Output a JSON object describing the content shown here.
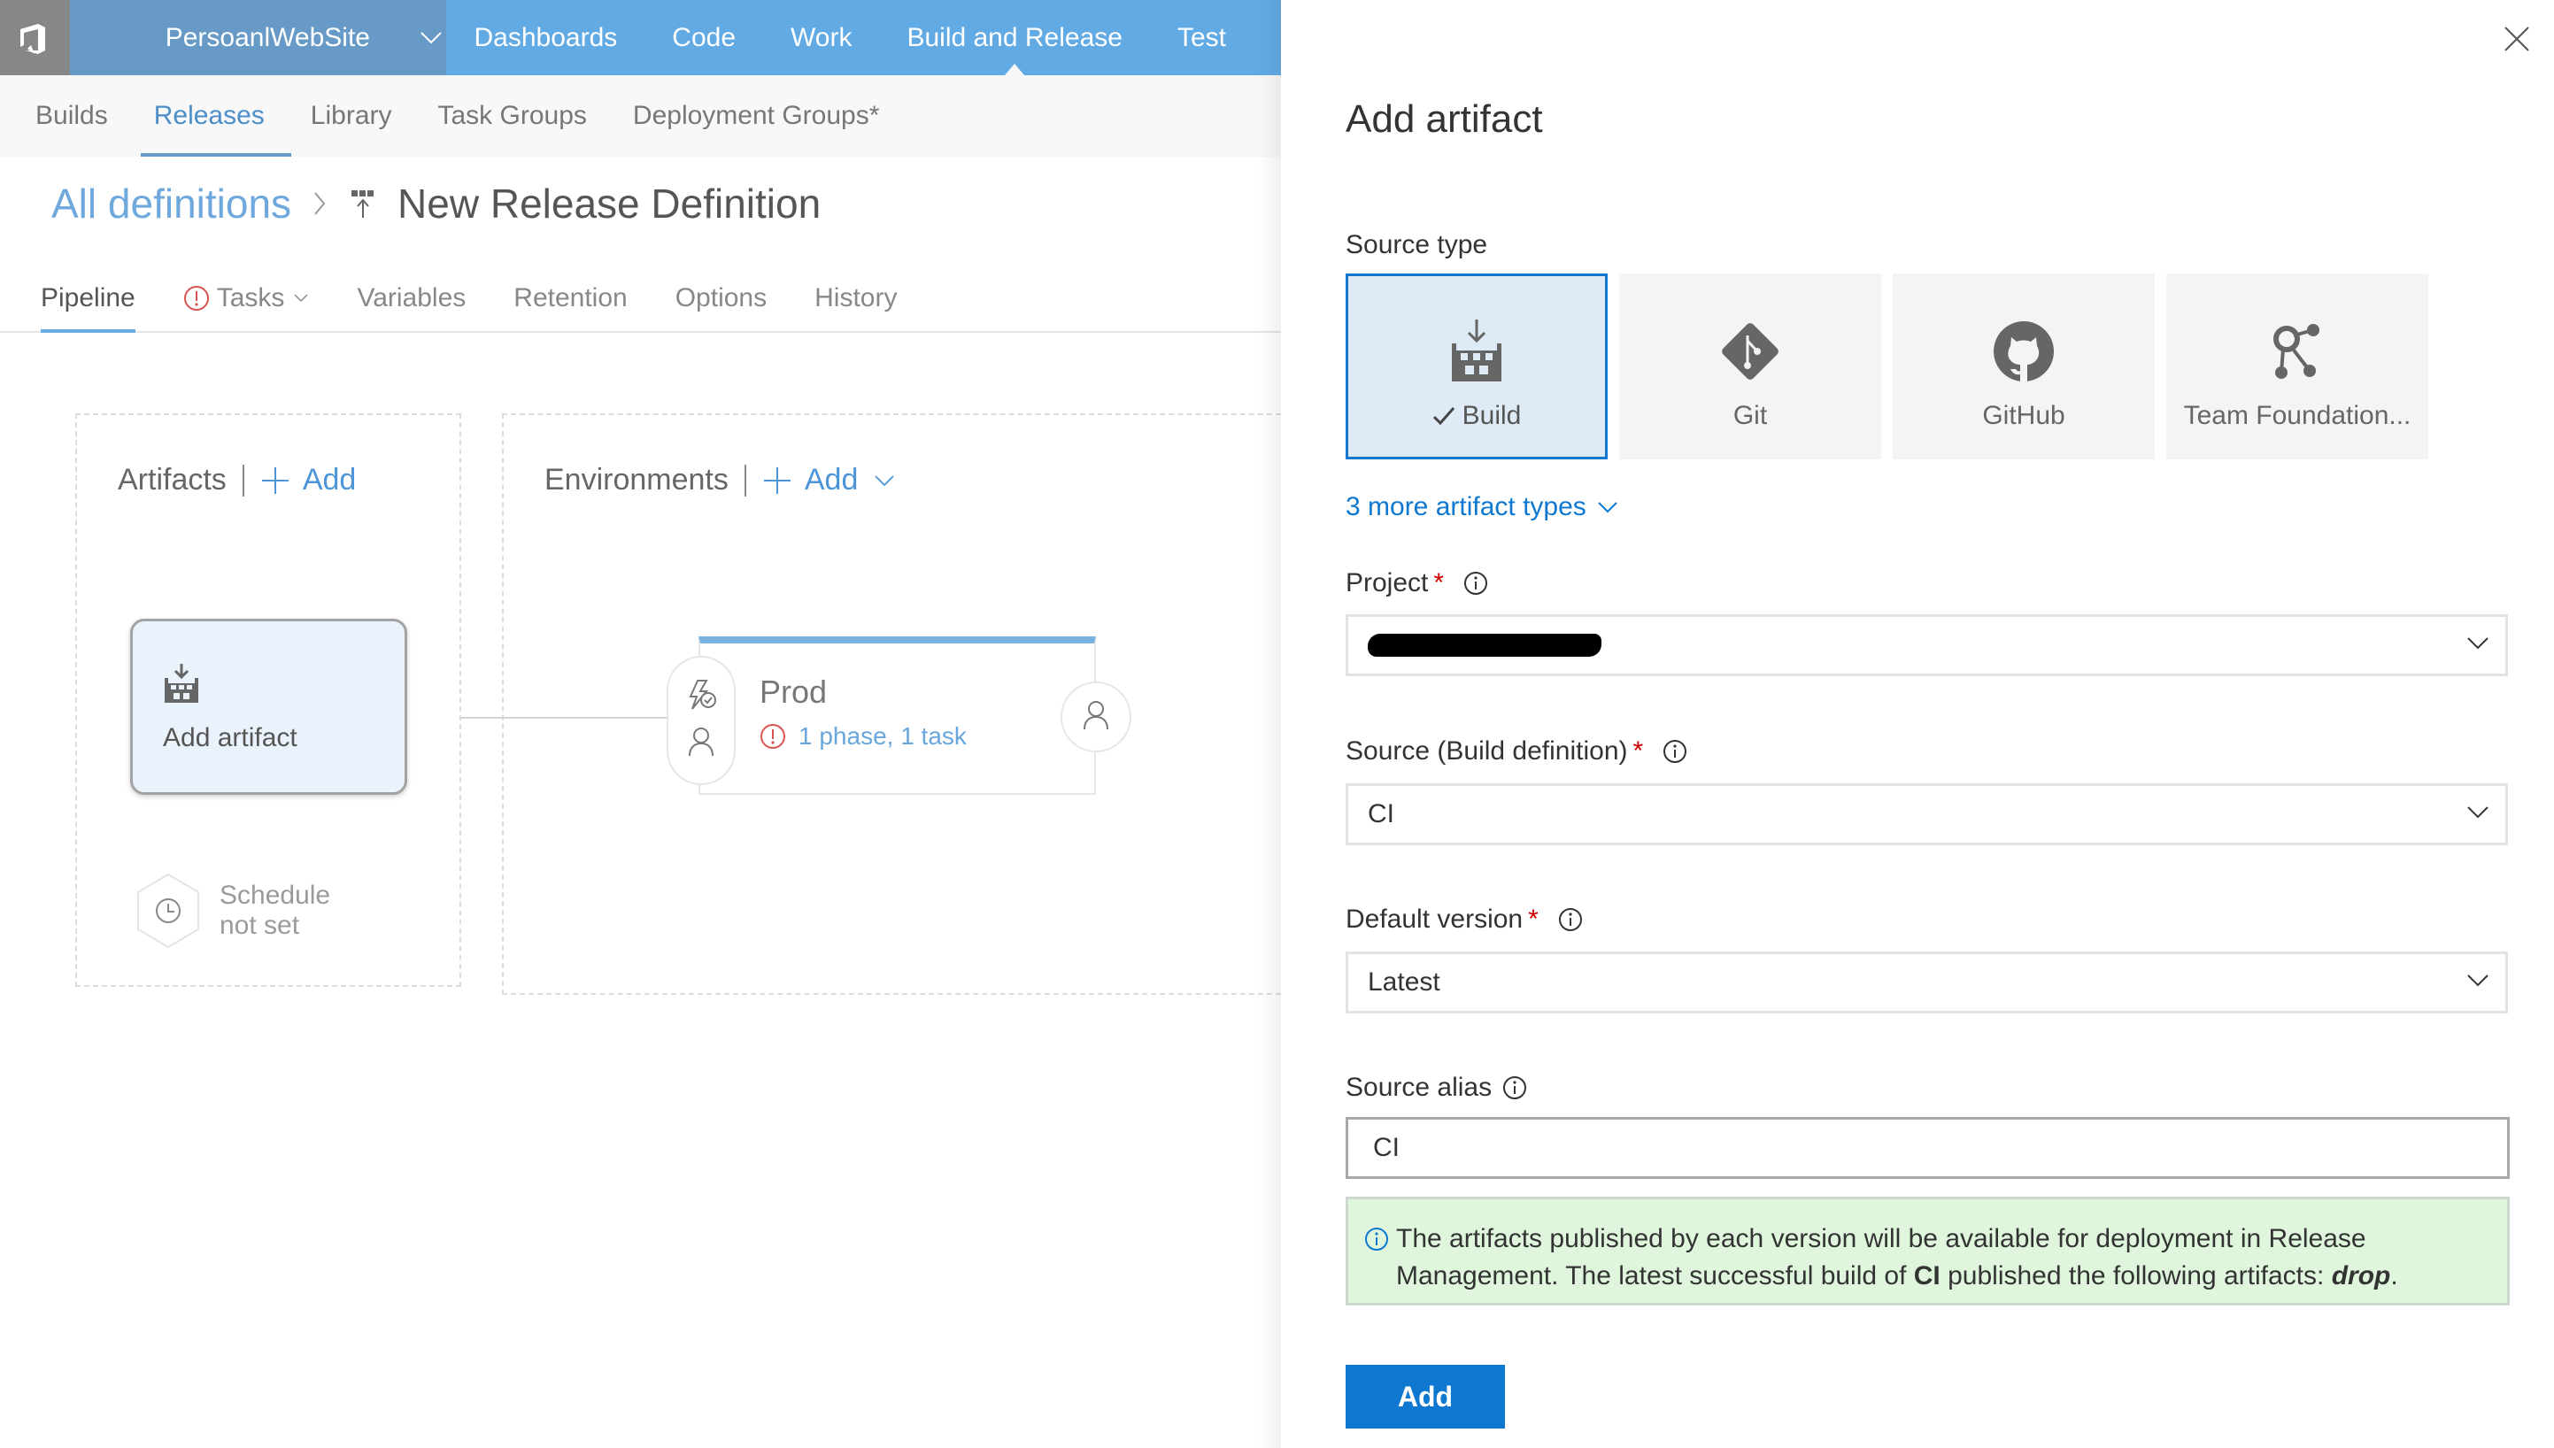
{
  "topbar": {
    "project_name": "PersoanlWebSite",
    "nav": [
      {
        "label": "Dashboards",
        "active": false
      },
      {
        "label": "Code",
        "active": false
      },
      {
        "label": "Work",
        "active": false
      },
      {
        "label": "Build and Release",
        "active": true
      },
      {
        "label": "Test",
        "active": false
      }
    ]
  },
  "subnav": {
    "items": [
      {
        "label": "Builds",
        "active": false
      },
      {
        "label": "Releases",
        "active": true
      },
      {
        "label": "Library",
        "active": false
      },
      {
        "label": "Task Groups",
        "active": false
      },
      {
        "label": "Deployment Groups*",
        "active": false
      }
    ]
  },
  "breadcrumb": {
    "parent": "All definitions",
    "title": "New Release Definition"
  },
  "tabs": [
    {
      "label": "Pipeline",
      "active": true
    },
    {
      "label": "Tasks",
      "warning": true,
      "has_dropdown": true
    },
    {
      "label": "Variables"
    },
    {
      "label": "Retention"
    },
    {
      "label": "Options"
    },
    {
      "label": "History"
    }
  ],
  "pipeline": {
    "artifacts": {
      "header": "Artifacts",
      "add_label": "Add",
      "card_label": "Add artifact",
      "schedule_line1": "Schedule",
      "schedule_line2": "not set"
    },
    "environments": {
      "header": "Environments",
      "add_label": "Add",
      "node": {
        "name": "Prod",
        "status": "1 phase, 1 task"
      }
    }
  },
  "panel": {
    "title": "Add artifact",
    "source_type_label": "Source type",
    "source_types": [
      {
        "label": "Build",
        "icon": "build-icon",
        "selected": true
      },
      {
        "label": "Git",
        "icon": "git-icon",
        "selected": false
      },
      {
        "label": "GitHub",
        "icon": "github-icon",
        "selected": false
      },
      {
        "label": "Team Foundation...",
        "icon": "tfvc-icon",
        "selected": false
      }
    ],
    "more_types": "3 more artifact types",
    "project": {
      "label": "Project",
      "required": "*",
      "value": "[redacted]"
    },
    "source": {
      "label": "Source (Build definition)",
      "required": "*",
      "value": "CI"
    },
    "default_version": {
      "label": "Default version",
      "required": "*",
      "value": "Latest"
    },
    "source_alias": {
      "label": "Source alias",
      "value": "CI"
    },
    "info": {
      "text1": "The artifacts published by each version will be available for deployment in Release Management. The latest successful build of ",
      "bold": "CI",
      "text2": " published the following artifacts: ",
      "artifact": "drop",
      "text3": "."
    },
    "add_button": "Add"
  },
  "colors": {
    "accent": "#0e78d0",
    "topbar": "#62aae4",
    "project_bar": "#679ac6",
    "warning": "#d9534f",
    "info_bg": "#dff6dd"
  }
}
